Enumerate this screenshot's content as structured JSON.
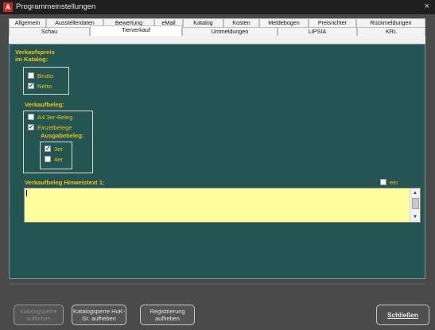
{
  "window": {
    "title": "Programmeinstellungen",
    "close_label": "×",
    "app_icon": "A"
  },
  "tabs_row1": [
    "Allgemein",
    "Ausstellerdaten",
    "Bewertung",
    "eMail",
    "Katalog",
    "Kosten",
    "Meldebogen",
    "Preisrichter",
    "Rückmeldungen"
  ],
  "tabs_row2": [
    "Schau",
    "Tierverkauf",
    "Ummeldungen",
    "LIPSIA",
    "KRL"
  ],
  "active_tab": "Tierverkauf",
  "verkaufspreis": {
    "title_line1": "Verkaufspreis",
    "title_line2": "im Katalog:",
    "options": [
      {
        "label": "Brutto",
        "checked": false
      },
      {
        "label": "Netto",
        "checked": true
      }
    ]
  },
  "verkaufbeleg": {
    "title": "Verkaufbeleg:",
    "options": [
      {
        "label": "A4 3er-Beleg",
        "checked": false
      },
      {
        "label": "Einzelbelege",
        "checked": true
      }
    ],
    "ausgabe_title": "Ausgabebeleg:",
    "ausgabe_options": [
      {
        "label": "3er",
        "checked": true
      },
      {
        "label": "4er",
        "checked": false
      }
    ]
  },
  "hinweis": {
    "title": "Verkaufbeleg Hinweistext 1:",
    "ein_label": "ein",
    "ein_checked": false,
    "text_value": ""
  },
  "buttons": {
    "katalogsperre_aufheben": "Katalogsperre aufheben",
    "katalogsperre_huk": "Katalogsperre HuK-Gr. aufheben",
    "registrierung": "Registrierung aufheben",
    "schliessen": "Schließen"
  },
  "colors": {
    "panel_bg": "#245553",
    "label_yellow": "#f2c311",
    "textarea_bg": "#ffff9e"
  }
}
